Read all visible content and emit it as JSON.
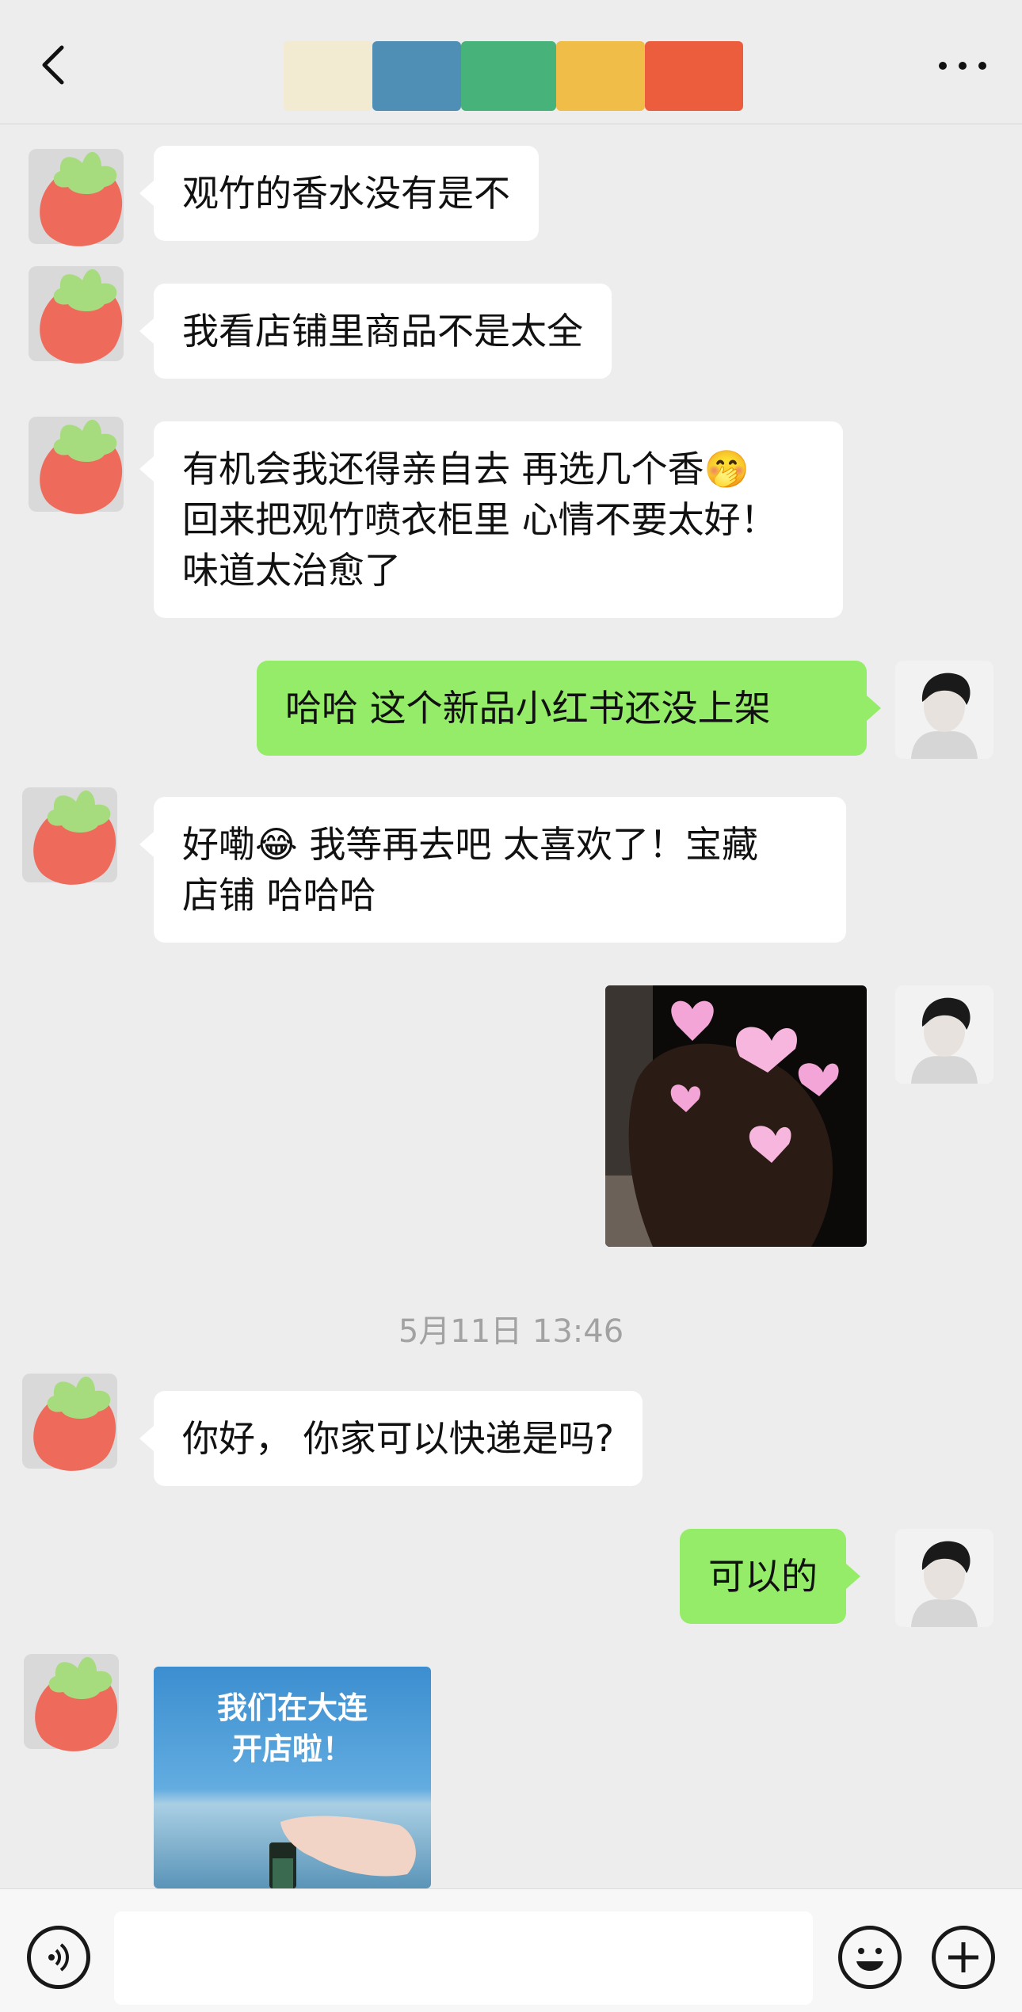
{
  "header": {
    "back_icon": "chevron-left-icon",
    "more_icon": "more-dots-icon",
    "title_blocks": [
      "#f3ead2",
      "#4f8fb5",
      "#47b37a",
      "#efbd48",
      "#ec5d3e"
    ]
  },
  "messages": [
    {
      "side": "in",
      "text": "观竹的香水没有是不"
    },
    {
      "side": "in",
      "text": "我看店铺里商品不是太全"
    },
    {
      "side": "in",
      "text": "有机会我还得亲自去 再选几个香🤭\n回来把观竹喷衣柜里 心情不要太好！\n味道太治愈了"
    },
    {
      "side": "out",
      "text": "哈哈 这个新品小红书还没上架"
    },
    {
      "side": "in",
      "text": "好嘞😂 我等再去吧 太喜欢了！宝藏\n店铺 哈哈哈"
    },
    {
      "side": "out",
      "type": "image"
    },
    {
      "side": "in",
      "text": "你好， 你家可以快递是吗?"
    },
    {
      "side": "out",
      "text": "可以的"
    },
    {
      "side": "in",
      "type": "image",
      "image_text": [
        "我们在大连",
        "开店啦！"
      ]
    }
  ],
  "timestamp": "5月11日 13:46",
  "input_bar": {
    "voice_icon": "voice-icon",
    "emoji_icon": "emoji-icon",
    "plus_icon": "plus-icon",
    "placeholder": ""
  },
  "colors": {
    "background": "#ededed",
    "bubble_in": "#ffffff",
    "bubble_out": "#95ec69",
    "strawberry": "#ee6b5c",
    "leaf": "#a6dc7e"
  }
}
